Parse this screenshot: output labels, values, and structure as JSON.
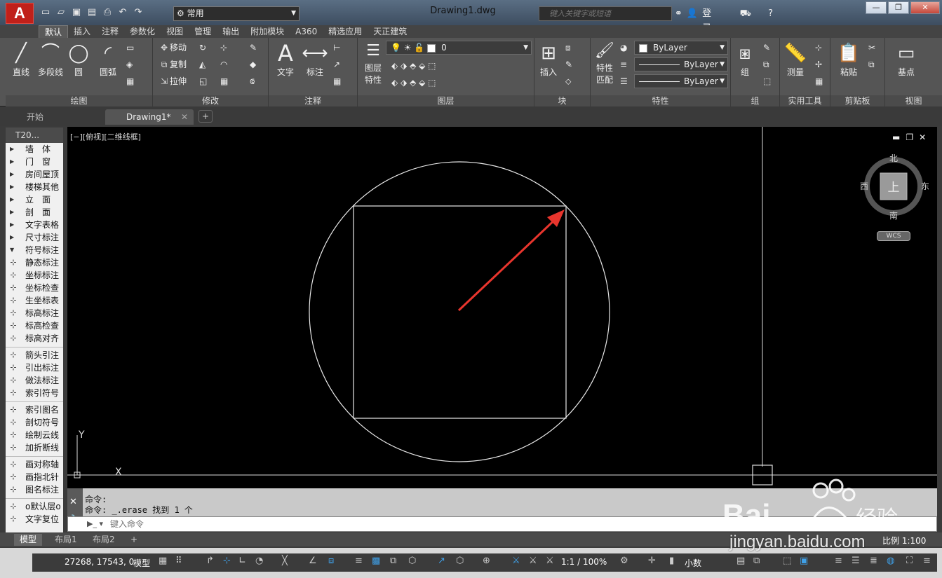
{
  "app": {
    "logo": "A",
    "document_title": "Drawing1.dwg",
    "workspace": "常用",
    "search_placeholder": "键入关键字或短语",
    "signin_label": "登录"
  },
  "ribbon_tabs": [
    "默认",
    "插入",
    "注释",
    "参数化",
    "视图",
    "管理",
    "输出",
    "附加模块",
    "A360",
    "精选应用",
    "天正建筑"
  ],
  "ribbon": {
    "draw": {
      "title": "绘图",
      "line": "直线",
      "polyline": "多段线",
      "circle": "圆",
      "arc": "圆弧"
    },
    "modify": {
      "title": "修改",
      "move": "移动",
      "copy": "复制",
      "stretch": "拉伸"
    },
    "annotation": {
      "title": "注释",
      "text": "文字",
      "dimension": "标注"
    },
    "layers": {
      "title": "图层",
      "layer_props": "图层\n特性",
      "layer_props_line1": "图层",
      "layer_props_line2": "特性",
      "current_layer": "0"
    },
    "block": {
      "title": "块",
      "insert": "插入"
    },
    "properties": {
      "title": "特性",
      "match_line1": "特性",
      "match_line2": "匹配",
      "color": "ByLayer",
      "linetype": "ByLayer",
      "lineweight": "ByLayer"
    },
    "groups": {
      "title": "组",
      "group": "组"
    },
    "utilities": {
      "title": "实用工具",
      "measure": "测量"
    },
    "clipboard": {
      "title": "剪贴板",
      "paste": "粘贴"
    },
    "view": {
      "title": "视图",
      "base": "基点"
    }
  },
  "file_tabs": [
    {
      "label": "开始"
    },
    {
      "label": "Drawing1*"
    }
  ],
  "palette": {
    "title": "T20...",
    "categories": [
      "墙　体",
      "门　窗",
      "房间屋顶",
      "楼梯其他",
      "立　面",
      "剖　面",
      "文字表格",
      "尺寸标注",
      "符号标注"
    ],
    "items": [
      "静态标注",
      "坐标标注",
      "坐标检查",
      "生坐标表",
      "标高标注",
      "标高检查",
      "标高对齐",
      "箭头引注",
      "引出标注",
      "做法标注",
      "索引符号",
      "索引图名",
      "剖切符号",
      "绘制云线",
      "加折断线",
      "画对称轴",
      "画指北针",
      "图名标注",
      "o默认层o",
      "文字复位"
    ]
  },
  "viewport": {
    "label": "[−][俯视][二维线框]",
    "compass": {
      "north": "北",
      "south": "南",
      "east": "东",
      "west": "西",
      "top": "上"
    },
    "wcs": "WCS",
    "x_axis": "X",
    "y_axis": "Y"
  },
  "command": {
    "history": [
      "命令:",
      "命令: _.erase 找到 1 个"
    ],
    "placeholder": "键入命令"
  },
  "layout_tabs": [
    "模型",
    "布局1",
    "布局2"
  ],
  "status": {
    "coords": "27268, 17543, 0",
    "model": "模型",
    "annotation_scale": "1:1 / 100%",
    "units": "小数",
    "scale": "比例 1:100"
  },
  "watermark": {
    "text": "jingyan.baidu.com",
    "brand": "Baidu经验"
  },
  "colors": {
    "canvas": "#000000",
    "accent": "#c0201a",
    "arrow": "#e8352d"
  }
}
